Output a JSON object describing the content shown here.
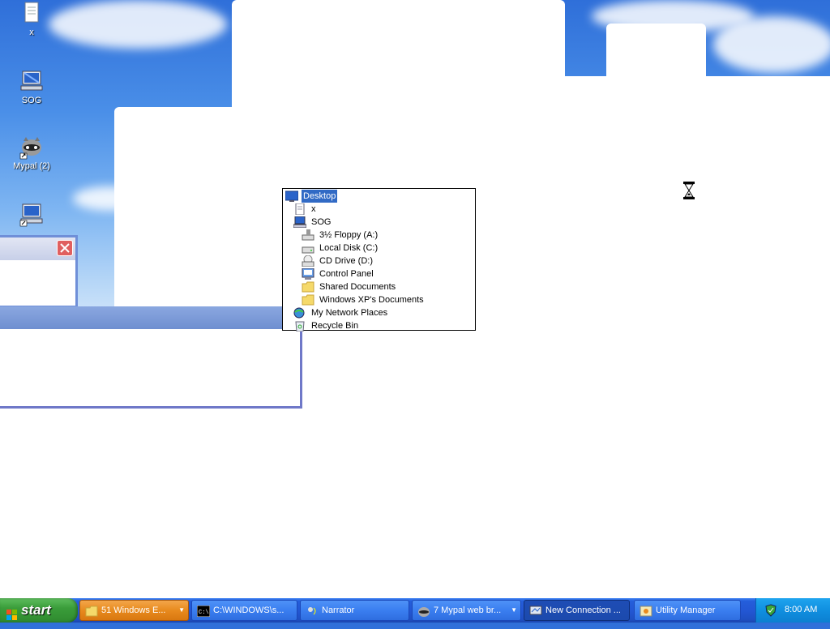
{
  "desktop": {
    "icons": [
      {
        "label": "x",
        "icon": "document-icon"
      },
      {
        "label": "SOG",
        "icon": "my-computer-icon"
      },
      {
        "label": "Mypal (2)",
        "icon": "mypal-raccoon-icon"
      },
      {
        "label": "",
        "icon": "my-computer-shortcut-icon"
      }
    ]
  },
  "tree": {
    "items": [
      {
        "label": "Desktop",
        "icon": "desktop-icon",
        "selected": true
      },
      {
        "label": "x",
        "icon": "document-icon"
      },
      {
        "label": "SOG",
        "icon": "my-computer-icon"
      },
      {
        "label": "3½ Floppy (A:)",
        "icon": "floppy-drive-icon"
      },
      {
        "label": "Local Disk (C:)",
        "icon": "hard-disk-icon"
      },
      {
        "label": "CD Drive (D:)",
        "icon": "cd-drive-icon"
      },
      {
        "label": "Control Panel",
        "icon": "control-panel-icon"
      },
      {
        "label": "Shared Documents",
        "icon": "folder-icon"
      },
      {
        "label": "Windows XP's Documents",
        "icon": "folder-icon"
      },
      {
        "label": "My Network Places",
        "icon": "network-places-icon"
      },
      {
        "label": "Recycle Bin",
        "icon": "recycle-bin-icon"
      }
    ]
  },
  "taskbar": {
    "start_label": "start",
    "tasks": [
      {
        "label": "51 Windows E...",
        "icon": "folder-icon",
        "state": "active"
      },
      {
        "label": "C:\\WINDOWS\\s...",
        "icon": "command-prompt-icon"
      },
      {
        "label": "Narrator",
        "icon": "narrator-icon"
      },
      {
        "label": "7 Mypal web br...",
        "icon": "mypal-raccoon-icon"
      },
      {
        "label": "New Connection ...",
        "icon": "new-connection-icon",
        "state": "pressed"
      },
      {
        "label": "Utility Manager",
        "icon": "utility-manager-icon"
      }
    ],
    "clock": "8:00 AM"
  },
  "colors": {
    "taskbar_blue": "#245edb",
    "start_green": "#3a9d3a",
    "active_task_orange": "#e88a1e",
    "selection_blue": "#316ac5",
    "tray_blue": "#108fe0"
  }
}
